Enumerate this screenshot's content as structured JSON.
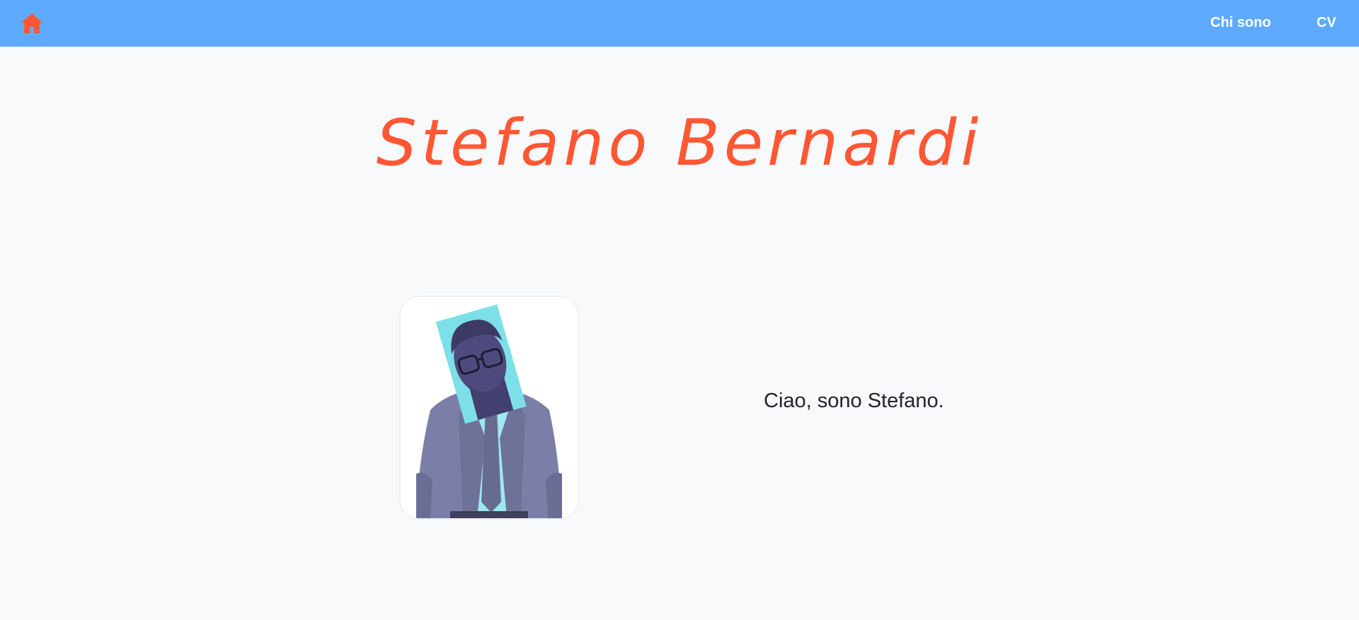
{
  "navbar": {
    "background_color": "#5eaaff",
    "home_icon": "home-icon",
    "home_icon_color": "#ff5733",
    "items": [
      {
        "label": "Chi sono"
      },
      {
        "label": "CV"
      }
    ]
  },
  "hero": {
    "title": "Stefano Bernardi",
    "title_color": "#ff5733"
  },
  "profile": {
    "photo": "person-portrait-photo",
    "intro": "Ciao, sono Stefano."
  }
}
